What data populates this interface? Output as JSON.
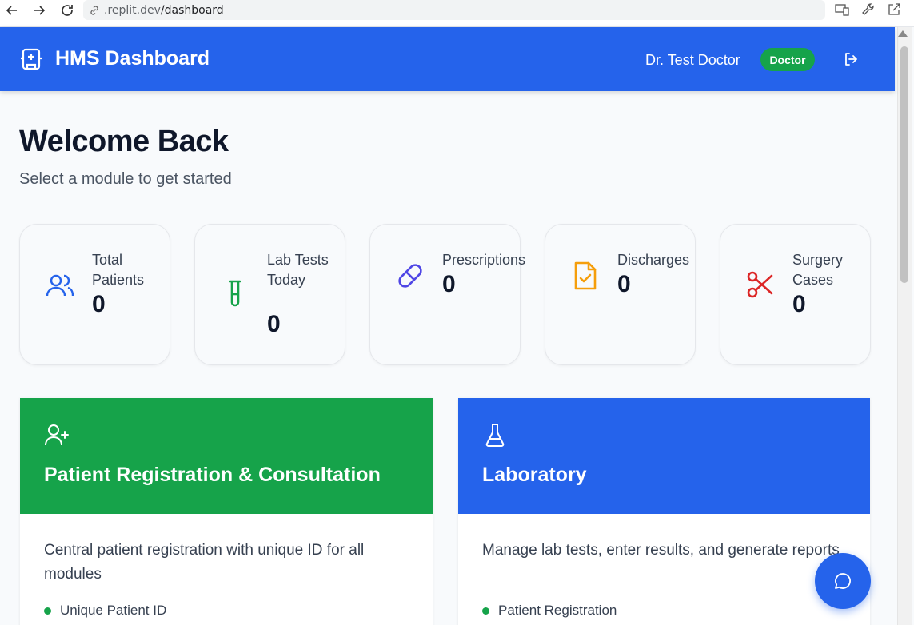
{
  "browser": {
    "url_host": ".replit.dev",
    "url_path": "/dashboard"
  },
  "header": {
    "title": "HMS Dashboard",
    "user_name": "Dr. Test Doctor",
    "role_badge": "Doctor"
  },
  "welcome": {
    "title": "Welcome Back",
    "subtitle": "Select a module to get started"
  },
  "stats": [
    {
      "label": "Total Patients",
      "value": "0",
      "icon": "users-icon",
      "color": "#2563eb"
    },
    {
      "label": "Lab Tests Today",
      "value": "0",
      "icon": "test-tube-icon",
      "color": "#16a34a"
    },
    {
      "label": "Prescriptions",
      "value": "0",
      "icon": "pill-icon",
      "color": "#4f46e5"
    },
    {
      "label": "Discharges",
      "value": "0",
      "icon": "file-check-icon",
      "color": "#f59e0b"
    },
    {
      "label": "Surgery Cases",
      "value": "0",
      "icon": "scissors-icon",
      "color": "#dc2626"
    }
  ],
  "modules": [
    {
      "title": "Patient Registration & Consultation",
      "description": "Central patient registration with unique ID for all modules",
      "feature": "Unique Patient ID",
      "color": "#16a34a",
      "icon": "user-plus-icon"
    },
    {
      "title": "Laboratory",
      "description": "Manage lab tests, enter results, and generate reports",
      "feature": "Patient Registration",
      "color": "#2563eb",
      "icon": "flask-icon"
    }
  ],
  "colors": {
    "primary": "#2563eb",
    "success": "#16a34a"
  },
  "fab_icon": "chat-icon"
}
